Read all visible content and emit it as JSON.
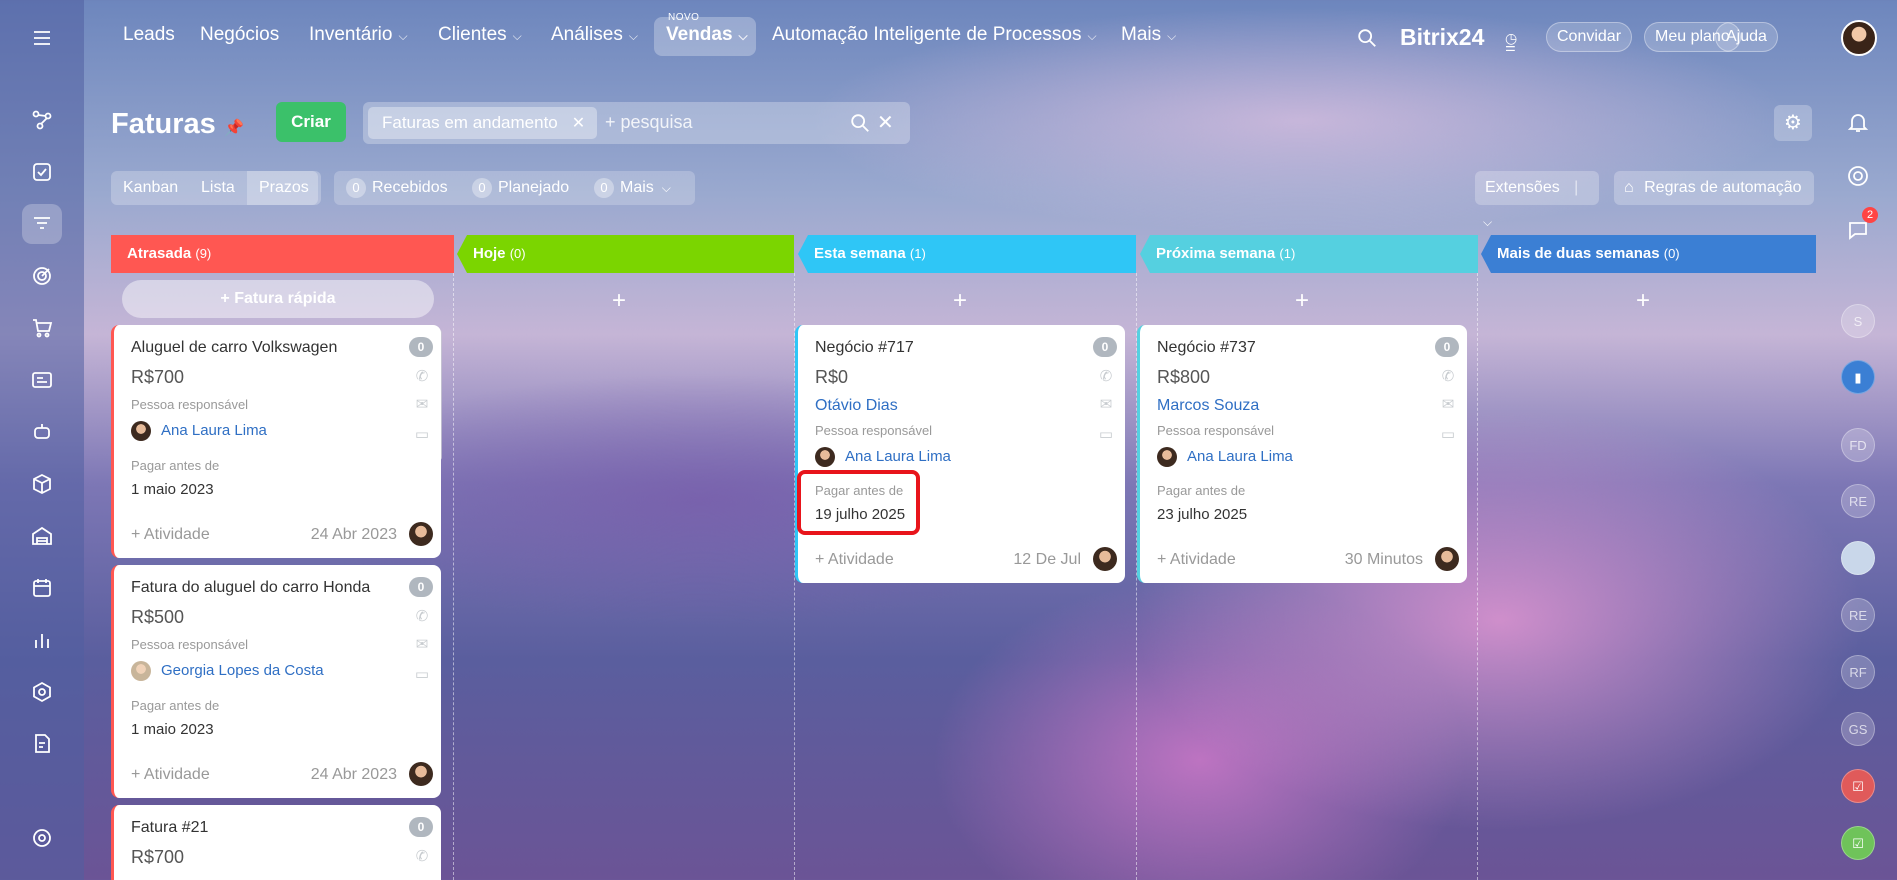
{
  "nav": {
    "items": [
      {
        "label": "Leads",
        "has_menu": false
      },
      {
        "label": "Negócios",
        "has_menu": false
      },
      {
        "label": "Inventário",
        "has_menu": true
      },
      {
        "label": "Clientes",
        "has_menu": true
      },
      {
        "label": "Análises",
        "has_menu": true
      },
      {
        "label": "Vendas",
        "has_menu": true,
        "active": true,
        "badge": "NOVO"
      },
      {
        "label": "Automação Inteligente de Processos",
        "has_menu": true
      },
      {
        "label": "Mais",
        "has_menu": true
      }
    ],
    "brand": "Bitrix24",
    "buttons": {
      "invite": "Convidar",
      "plan": "Meu plano",
      "help": "Ajuda"
    }
  },
  "page": {
    "title": "Faturas",
    "create_label": "Criar",
    "filter_chip": "Faturas em andamento",
    "search_placeholder": "+ pesquisa"
  },
  "views": {
    "kanban": "Kanban",
    "list": "Lista",
    "deadlines": "Prazos"
  },
  "counters": [
    {
      "count": "0",
      "label": "Recebidos"
    },
    {
      "count": "0",
      "label": "Planejado"
    },
    {
      "count": "0",
      "label": "Mais"
    }
  ],
  "toolbar": {
    "extensions": "Extensões",
    "automation": "Regras de automação"
  },
  "columns": [
    {
      "title": "Atrasada",
      "count": "(9)",
      "color": "#ff5752"
    },
    {
      "title": "Hoje",
      "count": "(0)",
      "color": "#7bd500"
    },
    {
      "title": "Esta semana",
      "count": "(1)",
      "color": "#2fc6f6"
    },
    {
      "title": "Próxima semana",
      "count": "(1)",
      "color": "#55d0e0"
    },
    {
      "title": "Mais de duas semanas",
      "count": "(0)",
      "color": "#3b7fd4"
    }
  ],
  "quick_invoice": "Fatura rápida",
  "plus": "+",
  "labels": {
    "responsible": "Pessoa responsável",
    "pay_before": "Pagar antes de",
    "activity": "+ Atividade"
  },
  "cards": {
    "c1": {
      "title": "Aluguel de carro Volkswagen",
      "badge": "0",
      "amount": "R$700",
      "person": "Ana Laura Lima",
      "due": "1 maio 2023",
      "time": "24 Abr 2023"
    },
    "c2": {
      "title": "Fatura do aluguel do carro Honda",
      "badge": "0",
      "amount": "R$500",
      "person": "Georgia Lopes da Costa",
      "due": "1 maio 2023",
      "time": "24 Abr 2023"
    },
    "c3": {
      "title": "Fatura #21",
      "badge": "0",
      "amount": "R$700"
    },
    "c4": {
      "title": "Negócio #717",
      "badge": "0",
      "amount": "R$0",
      "client": "Otávio Dias",
      "person": "Ana Laura Lima",
      "due": "19 julho 2025",
      "time": "12 De Jul"
    },
    "c5": {
      "title": "Negócio #737",
      "badge": "0",
      "amount": "R$800",
      "client": "Marcos Souza",
      "person": "Ana Laura Lima",
      "due": "23 julho 2025",
      "time": "30 Minutos"
    }
  },
  "right_sidebar": {
    "notif_count": "2",
    "avatars": [
      "S",
      "FD",
      "RE",
      "RE",
      "RF",
      "GS"
    ]
  },
  "colors": {
    "create": "#3bc16a",
    "link": "#2f6fc4",
    "highlight": "#e8141b"
  }
}
